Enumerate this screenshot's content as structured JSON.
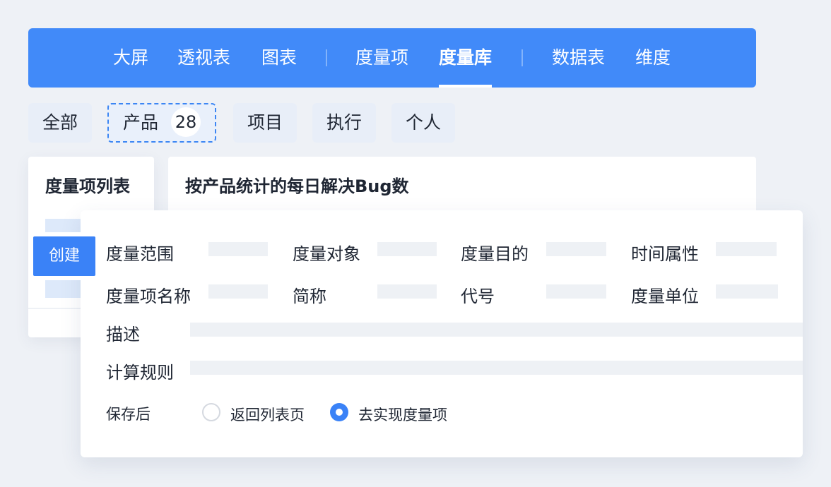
{
  "nav": {
    "items": [
      {
        "label": "大屏"
      },
      {
        "label": "透视表"
      },
      {
        "label": "图表"
      },
      {
        "label": "度量项"
      },
      {
        "label": "度量库"
      },
      {
        "label": "数据表"
      },
      {
        "label": "维度"
      }
    ],
    "active": "度量库",
    "bg_color": "#418af9"
  },
  "filters": {
    "chips": [
      {
        "label": "全部"
      },
      {
        "label": "产品",
        "count": "28"
      },
      {
        "label": "项目"
      },
      {
        "label": "执行"
      },
      {
        "label": "个人"
      }
    ],
    "selected": "产品"
  },
  "list_panel": {
    "title": "度量项列表",
    "create_label": "创建"
  },
  "detail": {
    "title": "按产品统计的每日解决Bug数"
  },
  "form": {
    "fields": {
      "scope": "度量范围",
      "object": "度量对象",
      "purpose": "度量目的",
      "time_attr": "时间属性",
      "name": "度量项名称",
      "short_name": "简称",
      "code": "代号",
      "unit": "度量单位",
      "description": "描述",
      "calc_rule": "计算规则"
    },
    "after_save": {
      "label": "保存后",
      "options": [
        {
          "label": "返回列表页",
          "checked": false
        },
        {
          "label": "去实现度量项",
          "checked": true
        }
      ]
    }
  },
  "colors": {
    "accent": "#3a82f7",
    "page_bg": "#eef1f6"
  }
}
